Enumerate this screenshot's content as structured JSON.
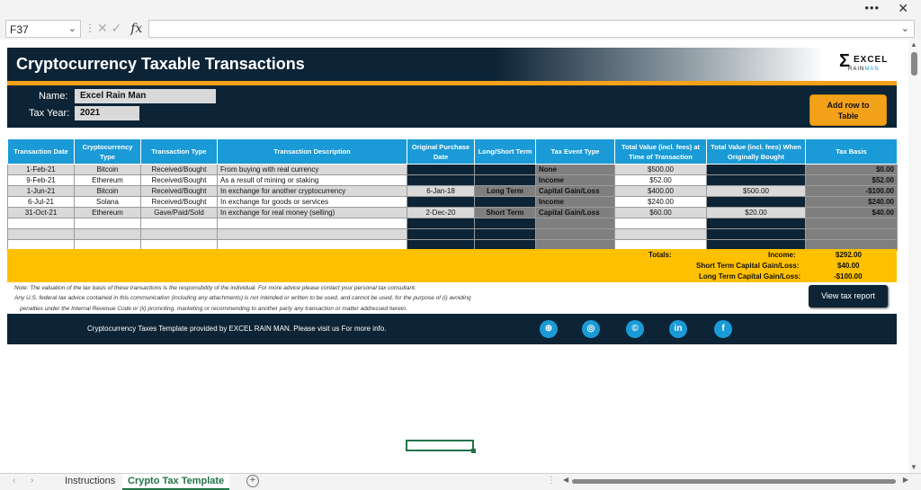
{
  "window": {
    "more_label": "•••",
    "close_label": "✕"
  },
  "formula_bar": {
    "cell_ref": "F37",
    "fx_label": "fx",
    "value": ""
  },
  "header": {
    "title": "Cryptocurrency Taxable Transactions",
    "logo_text": "EXCEL",
    "logo_sub": "RAIN MAN"
  },
  "info": {
    "name_label": "Name:",
    "name_value": "Excel Rain Man",
    "tax_year_label": "Tax Year:",
    "tax_year_value": "2021",
    "add_row_label_1": "Add row to",
    "add_row_label_2": "Table"
  },
  "table": {
    "headers": [
      "Transaction Date",
      "Cryptocurrency Type",
      "Transaction Type",
      "Transaction Description",
      "Original Purchase Date",
      "Long/Short Term",
      "Tax Event Type",
      "Total Value (incl. fees) at Time of Transaction",
      "Total Value (incl. fees) When Originally Bought",
      "Tax Basis"
    ],
    "rows": [
      {
        "date": "1-Feb-21",
        "crypto": "Bitcoin",
        "type": "Received/Bought",
        "desc": "From buying with real currency",
        "orig_date": "",
        "term": "",
        "event": "None",
        "value_now": "$500.00",
        "value_orig": "",
        "basis": "$0.00"
      },
      {
        "date": "9-Feb-21",
        "crypto": "Ethereum",
        "type": "Received/Bought",
        "desc": "As a result of mining or staking",
        "orig_date": "",
        "term": "",
        "event": "Income",
        "value_now": "$52.00",
        "value_orig": "",
        "basis": "$52.00"
      },
      {
        "date": "1-Jun-21",
        "crypto": "Bitcoin",
        "type": "Received/Bought",
        "desc": "In exchange for another cryptocurrency",
        "orig_date": "6-Jan-18",
        "term": "Long Term",
        "event": "Capital Gain/Loss",
        "value_now": "$400.00",
        "value_orig": "$500.00",
        "basis": "-$100.00"
      },
      {
        "date": "6-Jul-21",
        "crypto": "Solana",
        "type": "Received/Bought",
        "desc": "In exchange for goods or services",
        "orig_date": "",
        "term": "",
        "event": "Income",
        "value_now": "$240.00",
        "value_orig": "",
        "basis": "$240.00"
      },
      {
        "date": "31-Oct-21",
        "crypto": "Ethereum",
        "type": "Gave/Paid/Sold",
        "desc": "In exchange for real money (selling)",
        "orig_date": "2-Dec-20",
        "term": "Short Term",
        "event": "Capital Gain/Loss",
        "value_now": "$60.00",
        "value_orig": "$20.00",
        "basis": "$40.00"
      }
    ]
  },
  "totals": {
    "label": "Totals:",
    "income_label": "Income:",
    "income_value": "$292.00",
    "short_label": "Short Term Capital Gain/Loss:",
    "short_value": "$40.00",
    "long_label": "Long Term Capital Gain/Loss:",
    "long_value": "-$100.00"
  },
  "notes": {
    "line1": "Note: The valuation of the tax basis of these transactions is the responsibility of the individual. For more advice please contact your personal tax consultant.",
    "line2": "Any U.S. federal tax advice contained in this communication (including any attachments) is not intended or written to be used, and cannot be used, for the purpose of (i) avoiding",
    "line3": "penalties under the Internal Revenue Code or (ii) promoting, marketing or recommending to another party any transaction or matter addressed herein."
  },
  "view_report_label": "View tax report",
  "footer": {
    "text": "Cryptocurrency Taxes Template provided by EXCEL RAIN MAN. Please visit us For more info.",
    "icons": [
      "globe-icon",
      "instagram-icon",
      "copyright-icon",
      "linkedin-icon",
      "facebook-icon"
    ],
    "icon_glyphs": [
      "⊕",
      "◎",
      "©",
      "in",
      "f"
    ]
  },
  "tabs": [
    {
      "label": "Instructions",
      "active": false
    },
    {
      "label": "Crypto Tax Template",
      "active": true
    }
  ],
  "colors": {
    "navy": "#0d2436",
    "accent_orange": "#f4a11a",
    "header_blue": "#1a9ad6",
    "totals_yellow": "#ffc000",
    "excel_green": "#217346"
  }
}
